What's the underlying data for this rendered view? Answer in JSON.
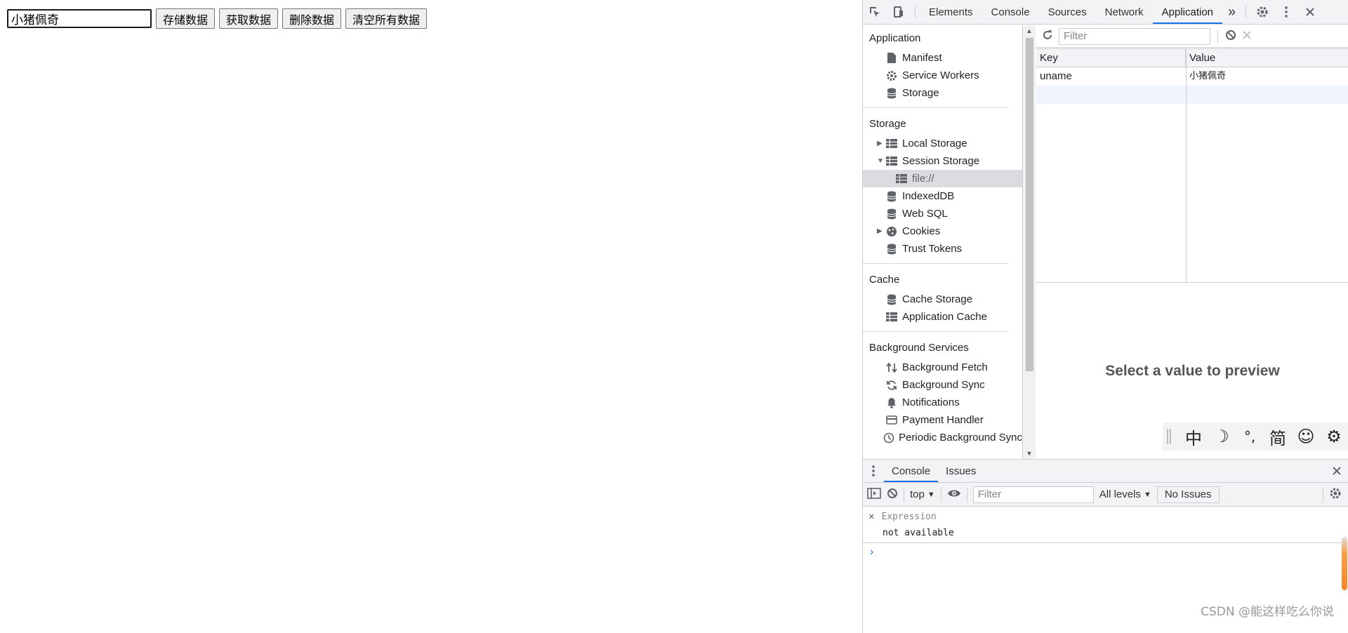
{
  "page": {
    "input_value": "小猪佩奇",
    "buttons": [
      "存储数据",
      "获取数据",
      "删除数据",
      "清空所有数据"
    ]
  },
  "devtools": {
    "tabs": [
      "Elements",
      "Console",
      "Sources",
      "Network",
      "Application"
    ],
    "more_tabs": "»",
    "sidebar": {
      "sections": [
        {
          "title": "Application",
          "items": [
            {
              "label": "Manifest",
              "icon": "file-icon"
            },
            {
              "label": "Service Workers",
              "icon": "gear-icon"
            },
            {
              "label": "Storage",
              "icon": "database-icon"
            }
          ]
        },
        {
          "title": "Storage",
          "items": [
            {
              "label": "Local Storage",
              "icon": "table-icon"
            },
            {
              "label": "Session Storage",
              "icon": "table-icon"
            },
            {
              "label": "file://",
              "icon": "table-icon"
            },
            {
              "label": "IndexedDB",
              "icon": "database-icon"
            },
            {
              "label": "Web SQL",
              "icon": "database-icon"
            },
            {
              "label": "Cookies",
              "icon": "cookie-icon"
            },
            {
              "label": "Trust Tokens",
              "icon": "database-icon"
            }
          ]
        },
        {
          "title": "Cache",
          "items": [
            {
              "label": "Cache Storage",
              "icon": "database-icon"
            },
            {
              "label": "Application Cache",
              "icon": "table-icon"
            }
          ]
        },
        {
          "title": "Background Services",
          "items": [
            {
              "label": "Background Fetch",
              "icon": "updown-icon"
            },
            {
              "label": "Background Sync",
              "icon": "sync-icon"
            },
            {
              "label": "Notifications",
              "icon": "bell-icon"
            },
            {
              "label": "Payment Handler",
              "icon": "card-icon"
            },
            {
              "label": "Periodic Background Sync",
              "icon": "clock-icon"
            }
          ]
        }
      ]
    },
    "storage_view": {
      "filter_placeholder": "Filter",
      "columns": [
        "Key",
        "Value"
      ],
      "rows": [
        {
          "key": "uname",
          "value": "小猪佩奇"
        }
      ],
      "preview_text": "Select a value to preview"
    },
    "drawer": {
      "tabs": [
        "Console",
        "Issues"
      ],
      "context": "top",
      "filter_placeholder": "Filter",
      "levels": "All levels",
      "issues_button": "No Issues",
      "expression_label": "Expression",
      "expression_value": "not available",
      "prompt": "›"
    }
  },
  "ime": {
    "items": [
      "中",
      "☽",
      "°,",
      "简",
      "☺",
      "⚙"
    ]
  },
  "watermark": "CSDN @能这样吃么你说",
  "colors": {
    "accent": "#1a73e8",
    "selected_bg": "#dadce0"
  }
}
